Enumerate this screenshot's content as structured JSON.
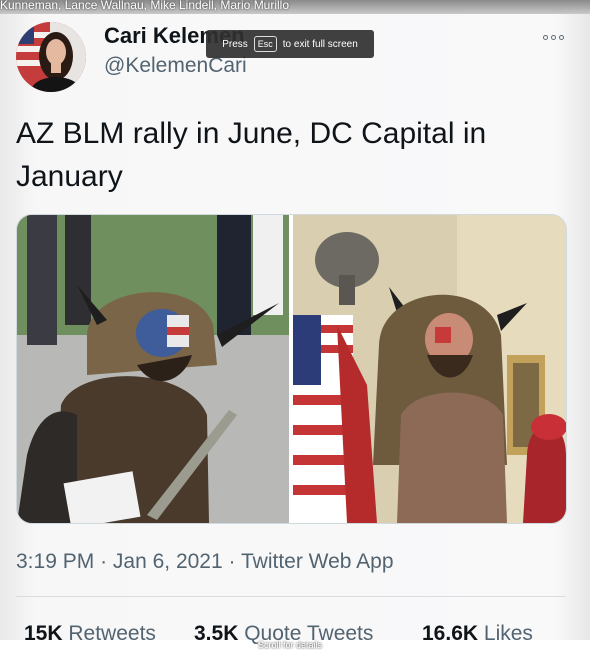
{
  "window": {
    "title_strip": "Kunneman, Lance Wallnau, Mike Lindell, Mario Murillo",
    "fullscreen_toast": {
      "prefix": "Press",
      "key": "Esc",
      "suffix": "to exit full screen"
    },
    "scroll_hint": "Scroll for details"
  },
  "tweet": {
    "author": {
      "display_name": "Cari Kelemen",
      "handle": "@KelemenCari",
      "avatar_icon": "profile-photo"
    },
    "more_icon": "more-options-icon",
    "text": "AZ BLM rally in June, DC Capital in January",
    "media": [
      {
        "description_icon": "photo-left"
      },
      {
        "description_icon": "photo-right"
      }
    ],
    "meta": {
      "time": "3:19 PM",
      "separator": "·",
      "date": "Jan 6, 2021",
      "source": "Twitter Web App"
    },
    "stats": {
      "retweets": {
        "count": "15K",
        "label": "Retweets"
      },
      "quotes": {
        "count": "3.5K",
        "label": "Quote Tweets"
      },
      "likes": {
        "count": "16.6K",
        "label": "Likes"
      }
    }
  },
  "colors": {
    "text": "#0f1419",
    "secondary": "#536471",
    "border": "#cfd9de"
  }
}
